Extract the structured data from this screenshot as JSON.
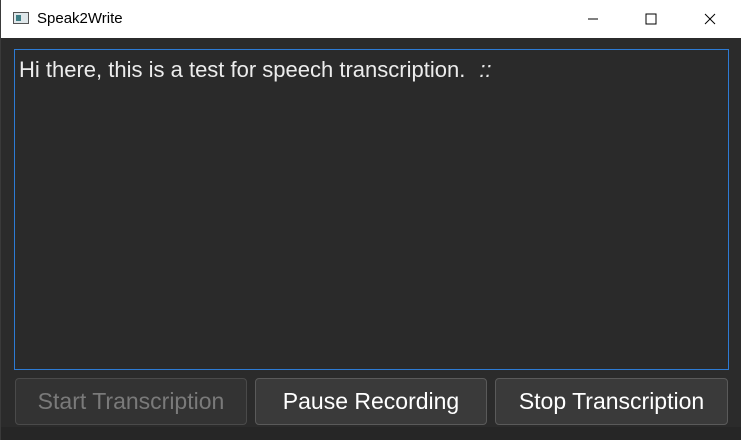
{
  "window": {
    "title": "Speak2Write"
  },
  "titlebar": {
    "app_icon": "app-window-icon",
    "minimize_icon": "minimize-icon",
    "maximize_icon": "maximize-icon",
    "close_icon": "close-icon"
  },
  "editor": {
    "text": "Hi there, this is a test for speech transcription.",
    "indicator": "::",
    "focus_color": "#2d7bd4"
  },
  "buttons": {
    "start_label": "Start Transcription",
    "start_enabled": false,
    "pause_label": "Pause Recording",
    "stop_label": "Stop Transcription"
  },
  "colors": {
    "background": "#2b2b2b",
    "text": "#ececec",
    "accent": "#2d7bd4"
  }
}
